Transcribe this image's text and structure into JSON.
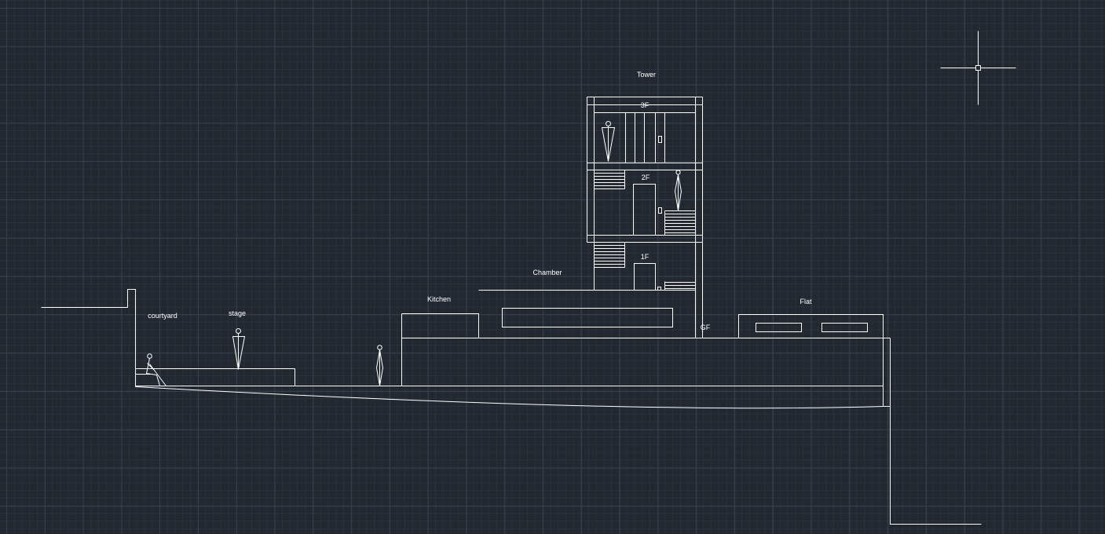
{
  "canvas": {
    "background_color": "#212830",
    "line_color": "#ffffff",
    "grid_visible": true,
    "cursor_icon": "crosshair-cursor"
  },
  "labels": {
    "tower": "Tower",
    "floor_3f": "3F",
    "floor_2f": "2F",
    "floor_1f": "1F",
    "floor_gf": "GF",
    "chamber": "Chamber",
    "kitchen": "Kitchen",
    "flat": "Flat",
    "courtyard": "courtyard",
    "stage": "stage"
  }
}
